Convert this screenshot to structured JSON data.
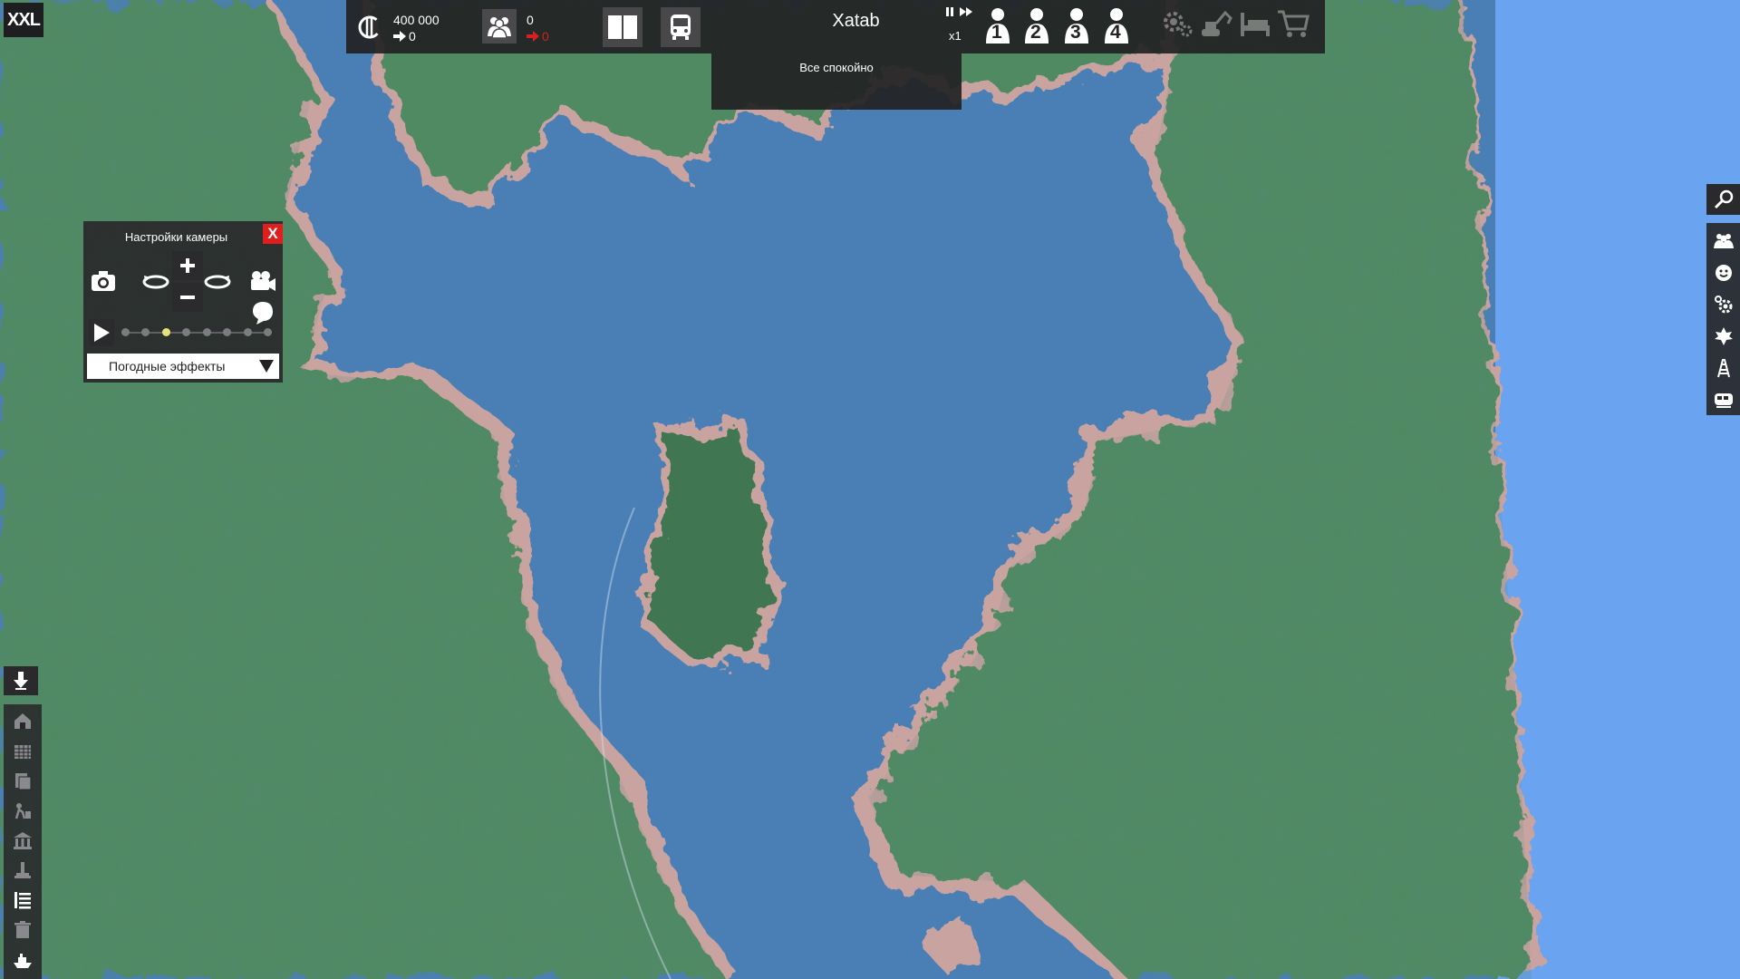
{
  "app": {
    "logo_text": "XXL"
  },
  "topbar": {
    "money": "400 000",
    "money_change": "0",
    "population": "0",
    "population_change": "0",
    "city_name": "Xatab",
    "speed": "x1",
    "slots": [
      "1",
      "2",
      "3",
      "4"
    ]
  },
  "notification": {
    "text": "Все спокойно"
  },
  "camera_panel": {
    "title": "Настройки камеры",
    "close_label": "X",
    "speed_steps": 8,
    "speed_selected_index": 2,
    "weather_label": "Погодные эффекты"
  },
  "left_toolbar": {
    "icons": [
      "residential-icon",
      "industry-icon",
      "office-icon",
      "roads-icon",
      "government-icon",
      "monument-icon",
      "list-icon",
      "trash-icon",
      "ship-icon"
    ]
  },
  "right_toolbar": {
    "icons": [
      "citizens-icon",
      "happiness-icon",
      "settings-icon",
      "leaf-icon",
      "tower-icon",
      "train-icon"
    ]
  },
  "colors": {
    "water": "#4a7fb6",
    "land": "#4f8a62",
    "sky": "#6aa3ef",
    "panel": "#28282a",
    "alert_red": "#e01e1e",
    "active_dot": "#e6e27a"
  }
}
